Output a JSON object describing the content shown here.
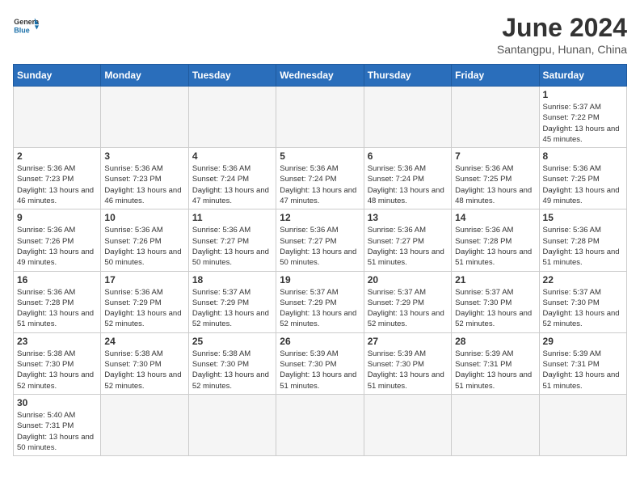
{
  "header": {
    "logo_general": "General",
    "logo_blue": "Blue",
    "month_title": "June 2024",
    "subtitle": "Santangpu, Hunan, China"
  },
  "weekdays": [
    "Sunday",
    "Monday",
    "Tuesday",
    "Wednesday",
    "Thursday",
    "Friday",
    "Saturday"
  ],
  "weeks": [
    [
      {
        "day": "",
        "info": ""
      },
      {
        "day": "",
        "info": ""
      },
      {
        "day": "",
        "info": ""
      },
      {
        "day": "",
        "info": ""
      },
      {
        "day": "",
        "info": ""
      },
      {
        "day": "",
        "info": ""
      },
      {
        "day": "1",
        "info": "Sunrise: 5:37 AM\nSunset: 7:22 PM\nDaylight: 13 hours and 45 minutes."
      }
    ],
    [
      {
        "day": "2",
        "info": "Sunrise: 5:36 AM\nSunset: 7:23 PM\nDaylight: 13 hours and 46 minutes."
      },
      {
        "day": "3",
        "info": "Sunrise: 5:36 AM\nSunset: 7:23 PM\nDaylight: 13 hours and 46 minutes."
      },
      {
        "day": "4",
        "info": "Sunrise: 5:36 AM\nSunset: 7:24 PM\nDaylight: 13 hours and 47 minutes."
      },
      {
        "day": "5",
        "info": "Sunrise: 5:36 AM\nSunset: 7:24 PM\nDaylight: 13 hours and 47 minutes."
      },
      {
        "day": "6",
        "info": "Sunrise: 5:36 AM\nSunset: 7:24 PM\nDaylight: 13 hours and 48 minutes."
      },
      {
        "day": "7",
        "info": "Sunrise: 5:36 AM\nSunset: 7:25 PM\nDaylight: 13 hours and 48 minutes."
      },
      {
        "day": "8",
        "info": "Sunrise: 5:36 AM\nSunset: 7:25 PM\nDaylight: 13 hours and 49 minutes."
      }
    ],
    [
      {
        "day": "9",
        "info": "Sunrise: 5:36 AM\nSunset: 7:26 PM\nDaylight: 13 hours and 49 minutes."
      },
      {
        "day": "10",
        "info": "Sunrise: 5:36 AM\nSunset: 7:26 PM\nDaylight: 13 hours and 50 minutes."
      },
      {
        "day": "11",
        "info": "Sunrise: 5:36 AM\nSunset: 7:27 PM\nDaylight: 13 hours and 50 minutes."
      },
      {
        "day": "12",
        "info": "Sunrise: 5:36 AM\nSunset: 7:27 PM\nDaylight: 13 hours and 50 minutes."
      },
      {
        "day": "13",
        "info": "Sunrise: 5:36 AM\nSunset: 7:27 PM\nDaylight: 13 hours and 51 minutes."
      },
      {
        "day": "14",
        "info": "Sunrise: 5:36 AM\nSunset: 7:28 PM\nDaylight: 13 hours and 51 minutes."
      },
      {
        "day": "15",
        "info": "Sunrise: 5:36 AM\nSunset: 7:28 PM\nDaylight: 13 hours and 51 minutes."
      }
    ],
    [
      {
        "day": "16",
        "info": "Sunrise: 5:36 AM\nSunset: 7:28 PM\nDaylight: 13 hours and 51 minutes."
      },
      {
        "day": "17",
        "info": "Sunrise: 5:36 AM\nSunset: 7:29 PM\nDaylight: 13 hours and 52 minutes."
      },
      {
        "day": "18",
        "info": "Sunrise: 5:37 AM\nSunset: 7:29 PM\nDaylight: 13 hours and 52 minutes."
      },
      {
        "day": "19",
        "info": "Sunrise: 5:37 AM\nSunset: 7:29 PM\nDaylight: 13 hours and 52 minutes."
      },
      {
        "day": "20",
        "info": "Sunrise: 5:37 AM\nSunset: 7:29 PM\nDaylight: 13 hours and 52 minutes."
      },
      {
        "day": "21",
        "info": "Sunrise: 5:37 AM\nSunset: 7:30 PM\nDaylight: 13 hours and 52 minutes."
      },
      {
        "day": "22",
        "info": "Sunrise: 5:37 AM\nSunset: 7:30 PM\nDaylight: 13 hours and 52 minutes."
      }
    ],
    [
      {
        "day": "23",
        "info": "Sunrise: 5:38 AM\nSunset: 7:30 PM\nDaylight: 13 hours and 52 minutes."
      },
      {
        "day": "24",
        "info": "Sunrise: 5:38 AM\nSunset: 7:30 PM\nDaylight: 13 hours and 52 minutes."
      },
      {
        "day": "25",
        "info": "Sunrise: 5:38 AM\nSunset: 7:30 PM\nDaylight: 13 hours and 52 minutes."
      },
      {
        "day": "26",
        "info": "Sunrise: 5:39 AM\nSunset: 7:30 PM\nDaylight: 13 hours and 51 minutes."
      },
      {
        "day": "27",
        "info": "Sunrise: 5:39 AM\nSunset: 7:30 PM\nDaylight: 13 hours and 51 minutes."
      },
      {
        "day": "28",
        "info": "Sunrise: 5:39 AM\nSunset: 7:31 PM\nDaylight: 13 hours and 51 minutes."
      },
      {
        "day": "29",
        "info": "Sunrise: 5:39 AM\nSunset: 7:31 PM\nDaylight: 13 hours and 51 minutes."
      }
    ],
    [
      {
        "day": "30",
        "info": "Sunrise: 5:40 AM\nSunset: 7:31 PM\nDaylight: 13 hours and 50 minutes."
      },
      {
        "day": "",
        "info": ""
      },
      {
        "day": "",
        "info": ""
      },
      {
        "day": "",
        "info": ""
      },
      {
        "day": "",
        "info": ""
      },
      {
        "day": "",
        "info": ""
      },
      {
        "day": "",
        "info": ""
      }
    ]
  ]
}
